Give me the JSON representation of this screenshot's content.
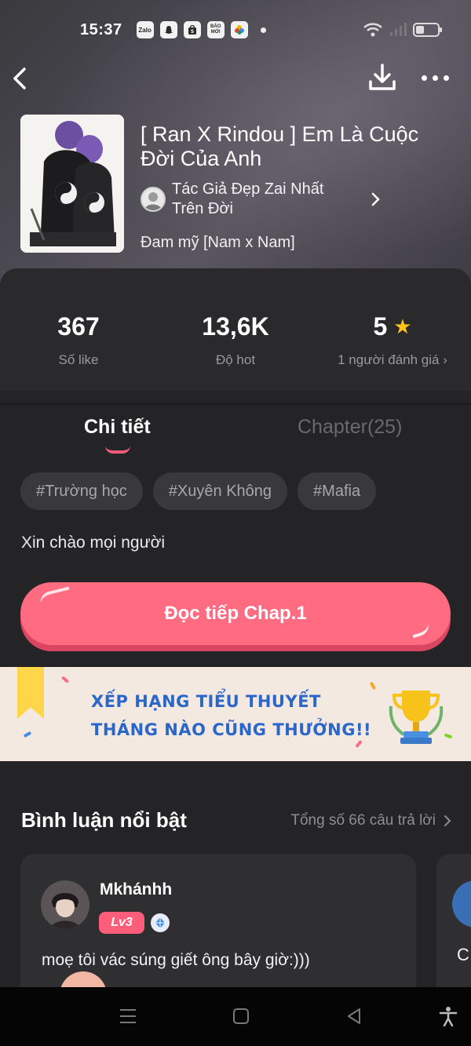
{
  "status_bar": {
    "time": "15:37",
    "notifications": [
      "Zalo",
      "snapchat-icon",
      "shopee-icon",
      "BÁO MỚI",
      "photos-icon"
    ]
  },
  "book": {
    "title": "[ Ran X Rindou ] Em Là Cuộc Đời Của Anh",
    "author": "Tác Giả Đẹp Zai Nhất Trên Đời",
    "genre": "Đam mỹ [Nam x Nam]"
  },
  "stats": {
    "likes": {
      "value": "367",
      "label": "Số like"
    },
    "hot": {
      "value": "13,6K",
      "label": "Độ hot"
    },
    "rating": {
      "value": "5",
      "label": "1 người đánh giá"
    }
  },
  "tabs": {
    "detail": "Chi tiết",
    "chapters": "Chapter(25)"
  },
  "tags": [
    "#Trường học",
    "#Xuyên Không",
    "#Mafia"
  ],
  "description": "Xin chào mọi người",
  "read_button": "Đọc tiếp Chap.1",
  "banner": {
    "line1": "XẾP HẠNG TIỂU THUYẾT",
    "line2": "THÁNG NÀO CŨNG THƯỞNG!!"
  },
  "comments_section": {
    "title": "Bình luận nổi bật",
    "total": "Tổng số 66 câu trả lời"
  },
  "comment": {
    "user": "Mkhánhh",
    "level": "Lv3",
    "text": "moẹ tôi vác súng giết ông bây giờ:)))"
  },
  "peek_comment": {
    "initial": "C"
  },
  "colors": {
    "accent": "#ff6b80",
    "star": "#ffc21a",
    "banner_text": "#2b66c9"
  }
}
